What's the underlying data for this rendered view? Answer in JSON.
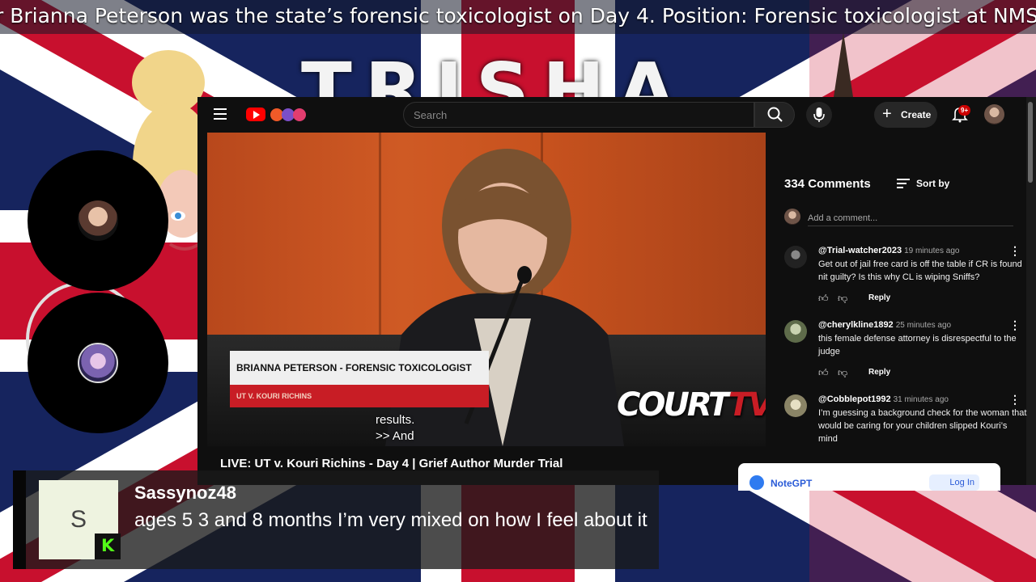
{
  "ticker": {
    "text": "r Brianna Peterson was the state’s forensic toxicologist on Day 4. Position: Forensic toxicologist at NMS"
  },
  "background": {
    "title_text": "TRISHA",
    "flag_colors": {
      "blue": "#16245e",
      "red": "#c8102e",
      "white": "#ffffff"
    }
  },
  "youtube": {
    "search": {
      "placeholder": "Search"
    },
    "create_label": "Create",
    "notification_count": "9+",
    "video": {
      "lower_third_name": "BRIANNA PETERSON - FORENSIC TOXICOLOGIST",
      "lower_third_case": "UT V. KOURI RICHINS",
      "caption_line1": "results.",
      "caption_line2": ">> And",
      "watermark_main": "COURT",
      "watermark_accent": "TV",
      "title": "LIVE: UT v. Kouri Richins - Day 4 | Grief Author Murder Trial"
    },
    "comments": {
      "count_label": "334 Comments",
      "sort_label": "Sort by",
      "add_placeholder": "Add a comment...",
      "items": [
        {
          "author": "@Trial-watcher2023",
          "time": "19 minutes ago",
          "text": "Get out of jail free card is off the table if CR is found nit guilty? Is this why CL is wiping Sniffs?",
          "reply": "Reply"
        },
        {
          "author": "@cherylkline1892",
          "time": "25 minutes ago",
          "text": "this female defense attorney is disrespectful to the judge",
          "reply": "Reply"
        },
        {
          "author": "@Cobblepot1992",
          "time": "31 minutes ago",
          "text": "I’m guessing a background check for the woman that would be caring for your children slipped Kouri’s mind",
          "reply": ""
        }
      ]
    }
  },
  "notegpt": {
    "label": "NoteGPT",
    "login": "Log In"
  },
  "chat": {
    "avatar_letter": "S",
    "username": "Sassynoz48",
    "message": "ages 5 3 and 8 months I’m very mixed on how I feel about it"
  }
}
